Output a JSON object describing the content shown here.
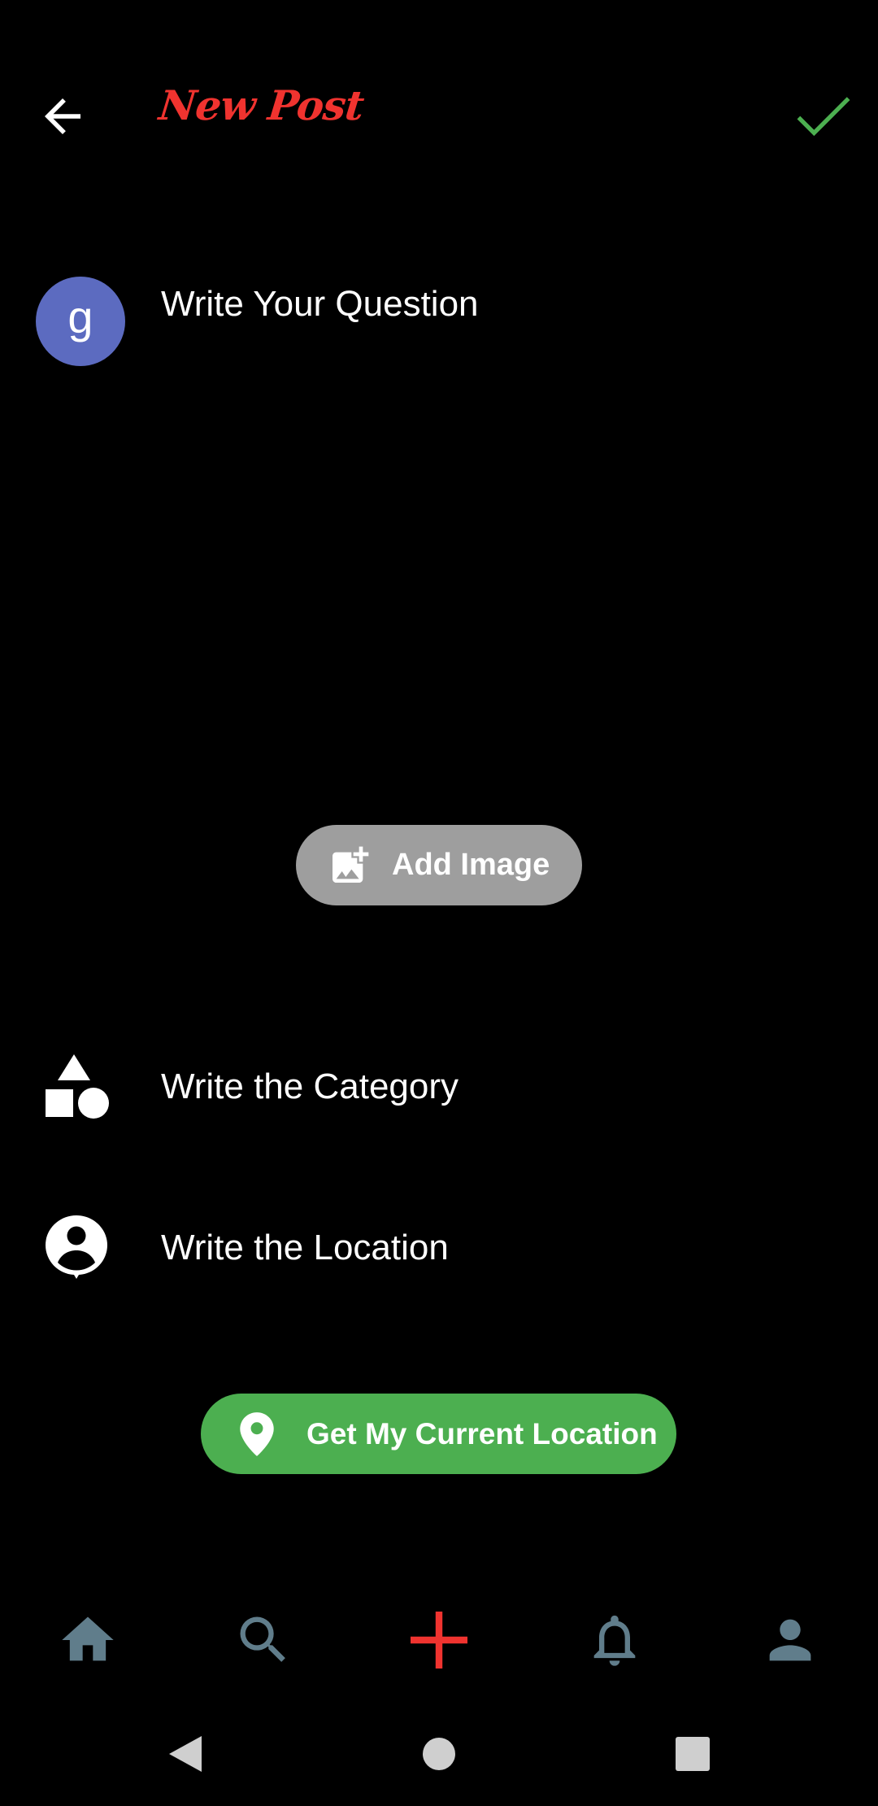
{
  "header": {
    "title": "New Post",
    "back_icon": "arrow-left-icon",
    "confirm_icon": "check-icon"
  },
  "question": {
    "avatar_letter": "g",
    "placeholder": "Write Your Question"
  },
  "add_image": {
    "label": "Add Image",
    "icon": "add-photo-icon"
  },
  "category": {
    "placeholder": "Write the Category",
    "icon": "category-shapes-icon"
  },
  "location": {
    "placeholder": "Write the Location",
    "icon": "person-pin-icon"
  },
  "current_location_button": {
    "label": "Get My Current Location",
    "icon": "map-pin-icon"
  },
  "bottom_nav": {
    "items": [
      "home-icon",
      "search-icon",
      "add-icon",
      "bell-icon",
      "profile-icon"
    ]
  },
  "system_nav": [
    "back-triangle-icon",
    "home-circle-icon",
    "recents-square-icon"
  ],
  "colors": {
    "background": "#000000",
    "title": "#f0332f",
    "confirm": "#4caf50",
    "avatar": "#5c6bc0",
    "add_image_pill": "#9e9e9e",
    "location_pill": "#4caf50",
    "nav_icon": "#607d8b",
    "nav_active": "#f0332f"
  }
}
